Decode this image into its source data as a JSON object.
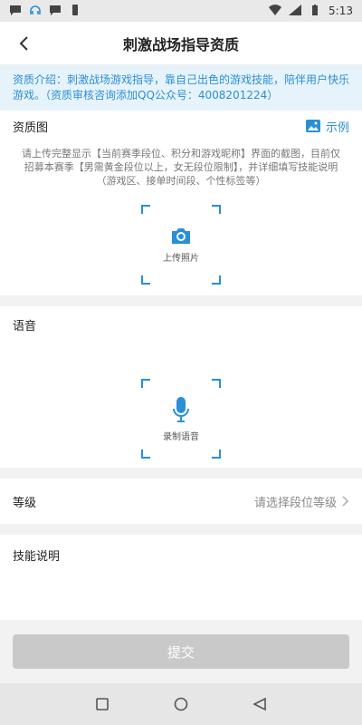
{
  "status_bar": {
    "time": "5:13"
  },
  "nav": {
    "title": "刺激战场指导资质"
  },
  "notice": {
    "text": "资质介绍：刺激战场游戏指导，靠自己出色的游戏技能，陪伴用户快乐游戏。（资质审核咨询添加QQ公众号：4008201224）"
  },
  "qualification": {
    "title": "资质图",
    "example_label": "示例",
    "description": "请上传完整显示【当前赛季段位、积分和游戏昵称】界面的截图，目前仅招募本赛季【男需黄金段位以上，女无段位限制】，并详细填写技能说明（游戏区、接单时间段、个性标签等）",
    "upload_label": "上传照片"
  },
  "voice": {
    "title": "语音",
    "record_label": "录制语音"
  },
  "level": {
    "label": "等级",
    "placeholder": "请选择段位等级"
  },
  "skills": {
    "title": "技能说明",
    "value": ""
  },
  "submit": {
    "label": "提交"
  },
  "colors": {
    "accent": "#2a8fd6",
    "notice_bg": "#e7f3fb",
    "submit_disabled": "#c9c9c9"
  }
}
